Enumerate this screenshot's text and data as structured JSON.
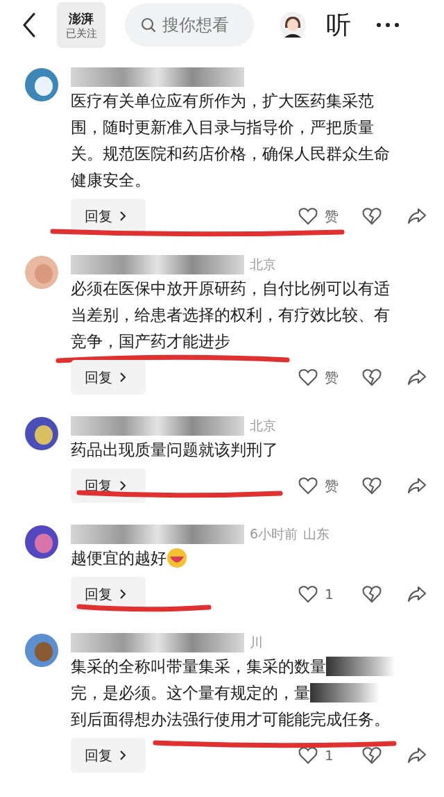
{
  "top_bar": {
    "logo": "澎湃",
    "follow_label": "已关注",
    "search": {
      "placeholder": "搜你想看"
    },
    "listen_label": "听"
  },
  "comments": [
    {
      "name_hidden": true,
      "lines": [
        {
          "text": "医疗有关单位应有所作为，扩大医药集采范",
          "redacted_tail": false
        },
        {
          "text": "围，随时更新准入目录与指导价，严把质量",
          "redacted_tail": false
        },
        {
          "text": "关。规范医院和药店价格，确保人民群众生命",
          "redacted_tail": false
        },
        {
          "text": "健康安全。",
          "redacted_tail": false
        }
      ],
      "emoji": false,
      "reply": "回复",
      "like_label": "赞",
      "kind": "across_actions"
    },
    {
      "name_hidden": true,
      "meta": [
        "北京"
      ],
      "lines": [
        {
          "text": "必须在医保中放开原研药，自付比例可以有适",
          "redacted_tail": false
        },
        {
          "text": "当差别，给患者选择的权利，有疗效比较、有",
          "redacted_tail": false
        },
        {
          "text": "竞争，国产药才能进步",
          "redacted_tail": false
        }
      ],
      "emoji": false,
      "reply": "回复",
      "like_label": "赞",
      "kind": "below_text"
    },
    {
      "name_hidden": true,
      "meta": [
        "北京"
      ],
      "lines": [
        {
          "text": "药品出现质量问题就该判刑了",
          "redacted_tail": false
        }
      ],
      "emoji": false,
      "reply": "回复",
      "like_label": "赞",
      "kind": "reply_to_like"
    },
    {
      "name_hidden": true,
      "meta": [
        "6小时前",
        "山东"
      ],
      "lines": [
        {
          "text": "越便宜的越好",
          "redacted_tail": false
        }
      ],
      "emoji": true,
      "reply": "回复",
      "like_label": "1",
      "kind": "under_reply"
    },
    {
      "name_hidden": true,
      "meta": [
        "川"
      ],
      "lines": [
        {
          "text": "集采的全称叫带量集采，集采的数量",
          "redacted_tail": true
        },
        {
          "text": "完，是必须。这个量有规定的，量",
          "redacted_tail": true
        },
        {
          "text": "到后面得想办法强行使用才可能能完成任务。",
          "redacted_tail": false
        }
      ],
      "emoji": false,
      "reply": "回复",
      "like_label": "1",
      "kind": "after_reply"
    }
  ]
}
